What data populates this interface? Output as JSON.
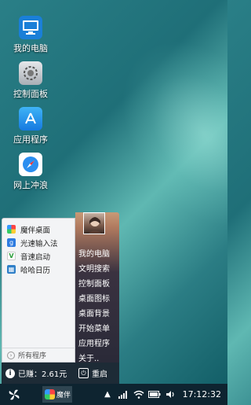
{
  "desktop": {
    "icons": [
      {
        "label": "我的电脑",
        "icon": "computer-icon"
      },
      {
        "label": "控制面板",
        "icon": "gear-icon"
      },
      {
        "label": "应用程序",
        "icon": "app-store-icon"
      },
      {
        "label": "网上冲浪",
        "icon": "compass-icon"
      }
    ]
  },
  "start_menu": {
    "left_items": [
      {
        "label": "魔伴桌面",
        "icon": "pinwheel-icon"
      },
      {
        "label": "光速输入法",
        "icon": "input-method-icon"
      },
      {
        "label": "音速启动",
        "icon": "launcher-icon"
      },
      {
        "label": "哈哈日历",
        "icon": "calendar-icon"
      }
    ],
    "all_programs_label": "所有程序",
    "right_items": [
      "我的电脑",
      "文明搜索",
      "控制面板",
      "桌面图标",
      "桌面背景",
      "开始菜单",
      "应用程序",
      "关于.."
    ],
    "earned_label": "已赚：2.61元",
    "restart_label": "重启"
  },
  "taskbar": {
    "start_icon": "pinwheel-icon",
    "task_label": "魔伴",
    "tray_icons": [
      "up-arrow-icon",
      "network-icon",
      "wifi-icon",
      "battery-icon",
      "volume-icon"
    ],
    "clock": "17:12:32"
  },
  "colors": {
    "taskbar_bg": "#0e2430",
    "menu_bottom_bg": "#1d2b36",
    "menu_left_bg": "#f3f4f6"
  }
}
